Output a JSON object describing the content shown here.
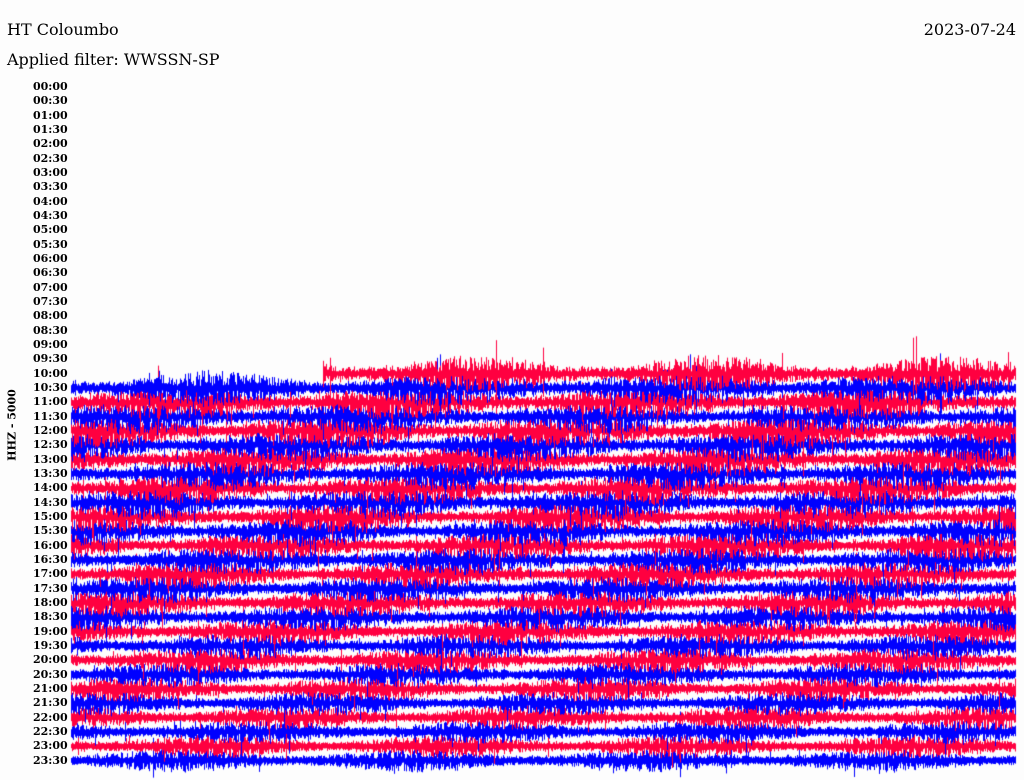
{
  "header": {
    "station": "HT Coloumbo",
    "date": "2023-07-24",
    "filter": "Applied filter: WWSSN-SP"
  },
  "chart_data": {
    "type": "line",
    "title": "HT Coloumbo",
    "ylabel": "HHZ - 5000",
    "tick_labels": [
      "00:00",
      "00:30",
      "01:00",
      "01:30",
      "02:00",
      "02:30",
      "03:00",
      "03:30",
      "04:00",
      "04:30",
      "05:00",
      "05:30",
      "06:00",
      "06:30",
      "07:00",
      "07:30",
      "08:00",
      "08:30",
      "09:00",
      "09:30",
      "10:00",
      "10:30",
      "11:00",
      "11:30",
      "12:00",
      "12:30",
      "13:00",
      "13:30",
      "14:00",
      "14:30",
      "15:00",
      "15:30",
      "16:00",
      "16:30",
      "17:00",
      "17:30",
      "18:00",
      "18:30",
      "19:00",
      "19:30",
      "20:00",
      "20:30",
      "21:00",
      "21:30",
      "22:00",
      "22:30",
      "23:00",
      "23:30"
    ],
    "row_minutes": 30,
    "data_start": "10:08",
    "series_colors": [
      "#ff0040",
      "#0000ff"
    ],
    "grid": false
  }
}
